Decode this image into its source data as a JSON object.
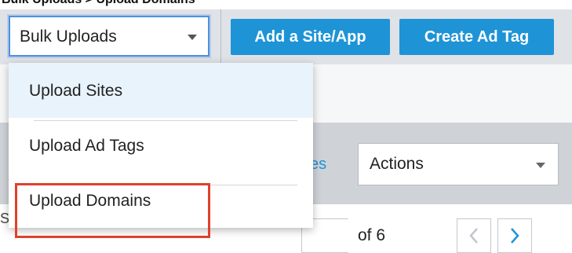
{
  "crop_title": "Bulk Uploads > Upload Domains",
  "toolbar": {
    "bulk_select_value": "Bulk Uploads",
    "add_site_label": "Add a Site/App",
    "create_ad_tag_label": "Create Ad Tag"
  },
  "dropdown": {
    "items": [
      {
        "label": "Upload Sites"
      },
      {
        "label": "Upload Ad Tags"
      },
      {
        "label": "Upload Domains"
      }
    ]
  },
  "filter_bar": {
    "partial_link_text": "es",
    "actions_select_value": "Actions"
  },
  "pagination": {
    "of_text": "of  6"
  },
  "edge_fragment": "S",
  "colors": {
    "accent_blue": "#1e94d7",
    "highlight_red": "#e0412b",
    "menu_hover": "#e8f3fb"
  },
  "icons": {
    "dropdown_caret": "caret-down-icon",
    "prev": "chevron-left-icon",
    "next": "chevron-right-icon"
  }
}
